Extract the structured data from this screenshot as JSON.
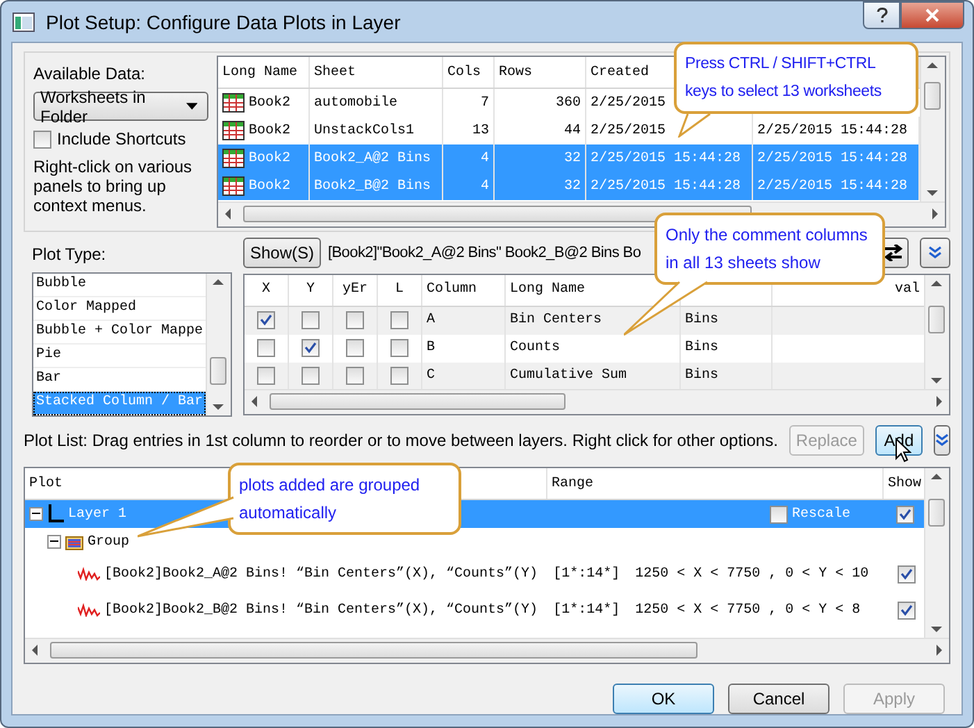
{
  "window": {
    "title": "Plot Setup: Configure Data Plots in Layer"
  },
  "available_data": {
    "label": "Available Data:",
    "dropdown": "Worksheets in Folder",
    "include_shortcuts": {
      "label": "Include Shortcuts",
      "checked": false
    },
    "hint": "Right-click on various panels to bring up context menus."
  },
  "data_table": {
    "columns": [
      "Long Name",
      "Sheet",
      "Cols",
      "Rows",
      "Created"
    ],
    "rows": [
      {
        "long_name": "Book2",
        "sheet": "automobile",
        "cols": "7",
        "rows": "360",
        "created": "2/25/2015",
        "selected": false
      },
      {
        "long_name": "Book2",
        "sheet": "UnstackCols1",
        "cols": "13",
        "rows": "44",
        "created": "2/25/2015",
        "column_6": "2/25/2015 15:44:28",
        "selected": false
      },
      {
        "long_name": "Book2",
        "sheet": "Book2_A@2 Bins",
        "cols": "4",
        "rows": "32",
        "created": "2/25/2015 15:44:28",
        "column_6": "2/25/2015 15:44:28",
        "selected": true
      },
      {
        "long_name": "Book2",
        "sheet": "Book2_B@2 Bins",
        "cols": "4",
        "rows": "32",
        "created": "2/25/2015 15:44:28",
        "column_6": "2/25/2015 15:44:28",
        "selected": true
      }
    ]
  },
  "plot_type": {
    "label": "Plot Type:",
    "items": [
      {
        "label": "Bubble",
        "selected": false
      },
      {
        "label": "Color Mapped",
        "selected": false
      },
      {
        "label": "Bubble + Color Mappe",
        "selected": false
      },
      {
        "label": "Pie",
        "selected": false
      },
      {
        "label": "Bar",
        "selected": false
      },
      {
        "label": "Stacked Column / Bar",
        "selected": true
      }
    ]
  },
  "columns_panel": {
    "show_button": "Show(S)",
    "info": "[Book2]\"Book2_A@2 Bins\" Book2_B@2 Bins Bo",
    "headers": [
      "X",
      "Y",
      "yEr",
      "L",
      "Column",
      "Long Name"
    ],
    "last_header": "val",
    "rows": [
      {
        "x": true,
        "y": false,
        "yer": false,
        "l": false,
        "column": "A",
        "long_name": "Bin Centers",
        "column_7": "Bins"
      },
      {
        "x": false,
        "y": true,
        "yer": false,
        "l": false,
        "column": "B",
        "long_name": "Counts",
        "column_7": "Bins"
      },
      {
        "x": false,
        "y": false,
        "yer": false,
        "l": false,
        "column": "C",
        "long_name": "Cumulative Sum",
        "column_7": "Bins"
      }
    ]
  },
  "plot_list": {
    "hint": "Plot List: Drag entries in 1st column to reorder or to move between layers. Right click for other options.",
    "buttons": [
      {
        "label": "Replace",
        "disabled": true
      },
      {
        "label": "Add",
        "disabled": false
      }
    ],
    "columns": [
      "Plot",
      "Range",
      "Show"
    ],
    "layers": [
      {
        "label": "Layer 1",
        "selected": true,
        "rescale": {
          "label": "Rescale",
          "checked": false
        },
        "show": true,
        "groups": [
          {
            "label": "Group",
            "plots": [
              {
                "label": "[Book2]Book2_A@2 Bins! “Bin Centers”(X), “Counts”(Y)",
                "range": "[1*:14*]",
                "limits": "1250 < X < 7750 , 0 < Y < 10",
                "show": true
              },
              {
                "label": "[Book2]Book2_B@2 Bins! “Bin Centers”(X), “Counts”(Y)",
                "range": "[1*:14*]",
                "limits": "1250 < X < 7750 , 0 < Y < 8",
                "show": true
              }
            ]
          }
        ]
      }
    ]
  },
  "footer_buttons": [
    {
      "label": "OK",
      "disabled": false
    },
    {
      "label": "Cancel",
      "disabled": false
    },
    {
      "label": "Apply",
      "disabled": true
    }
  ],
  "callouts": [
    {
      "text": "Press CTRL / SHIFT+CTRL keys to select 13 worksheets"
    },
    {
      "text": "Only the comment columns in all 13 sheets show"
    },
    {
      "text": "plots added are grouped automatically"
    }
  ]
}
